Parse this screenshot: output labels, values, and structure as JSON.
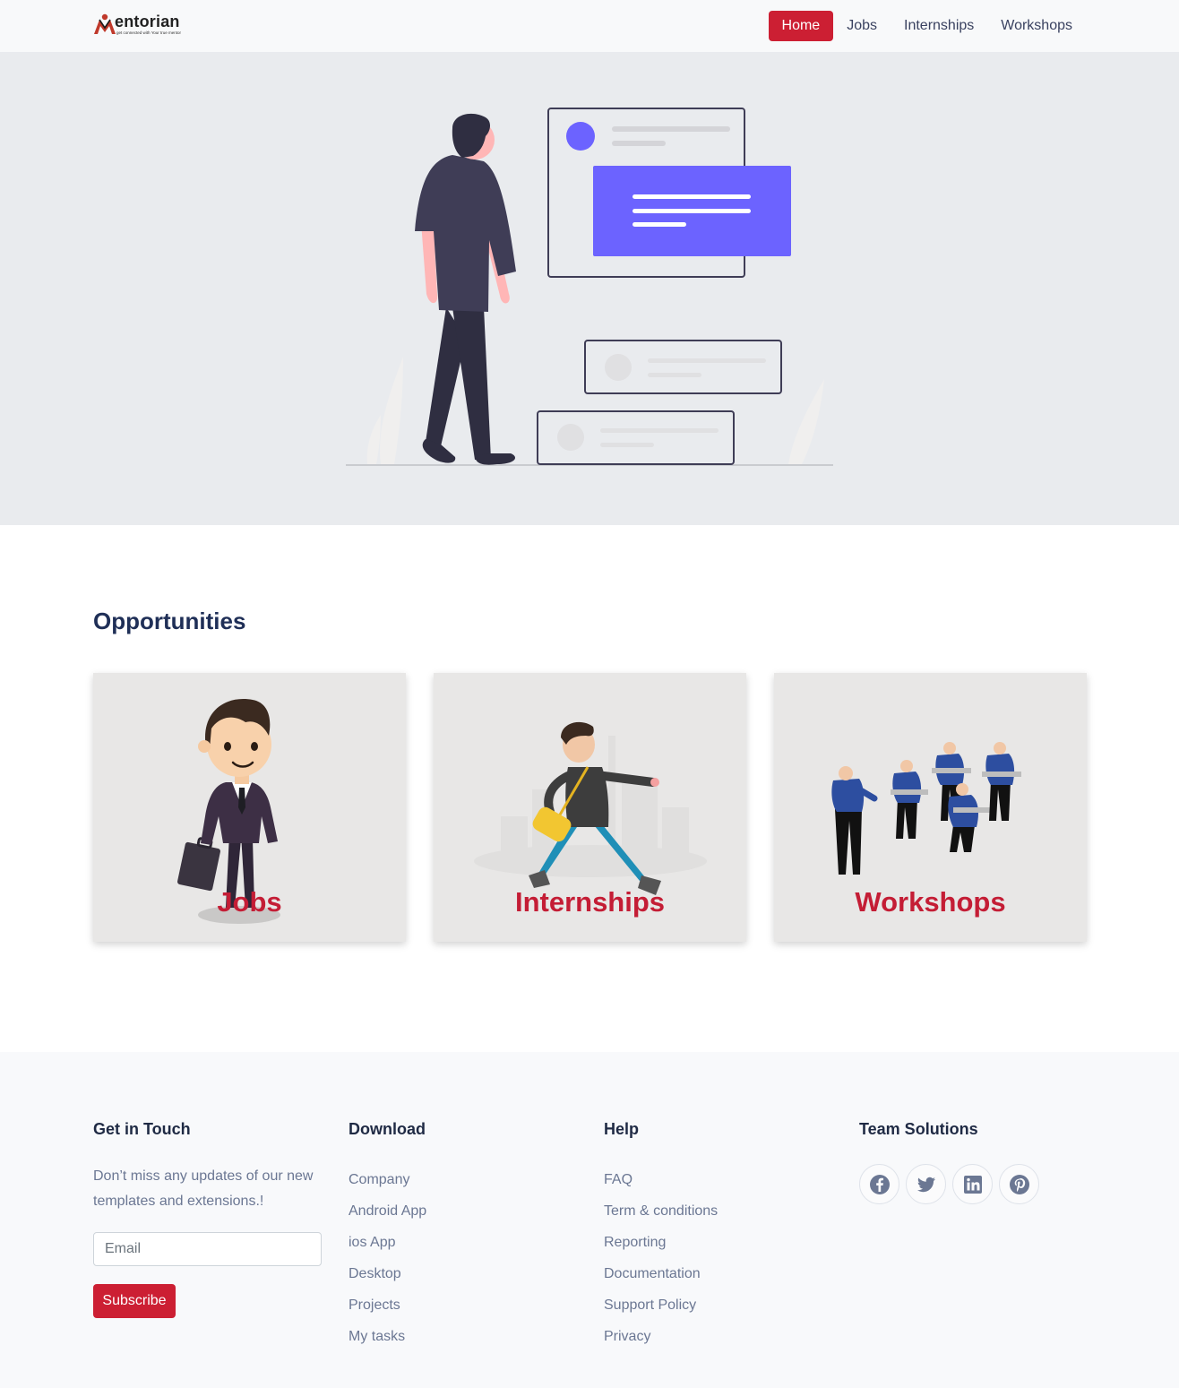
{
  "brand": {
    "name": "entorian",
    "tagline": "get connected with Your true mentor"
  },
  "nav": {
    "items": [
      {
        "label": "Home",
        "active": true
      },
      {
        "label": "Jobs",
        "active": false
      },
      {
        "label": "Internships",
        "active": false
      },
      {
        "label": "Workshops",
        "active": false
      }
    ]
  },
  "opportunities": {
    "title": "Opportunities",
    "cards": [
      {
        "label": "Jobs"
      },
      {
        "label": "Internships"
      },
      {
        "label": "Workshops"
      }
    ]
  },
  "footer": {
    "get_in_touch": {
      "heading": "Get in Touch",
      "text": "Don’t miss any updates of our new templates and extensions.!",
      "email_placeholder": "Email",
      "subscribe_label": "Subscribe"
    },
    "download": {
      "heading": "Download",
      "links": [
        "Company",
        "Android App",
        "ios App",
        "Desktop",
        "Projects",
        "My tasks"
      ]
    },
    "help": {
      "heading": "Help",
      "links": [
        "FAQ",
        "Term & conditions",
        "Reporting",
        "Documentation",
        "Support Policy",
        "Privacy"
      ]
    },
    "team": {
      "heading": "Team Solutions",
      "socials": [
        "facebook-icon",
        "twitter-icon",
        "linkedin-icon",
        "pinterest-icon"
      ]
    }
  },
  "colors": {
    "accent": "#cc1f33",
    "illustration_purple": "#6c63ff",
    "heading_navy": "#1f2f57"
  }
}
